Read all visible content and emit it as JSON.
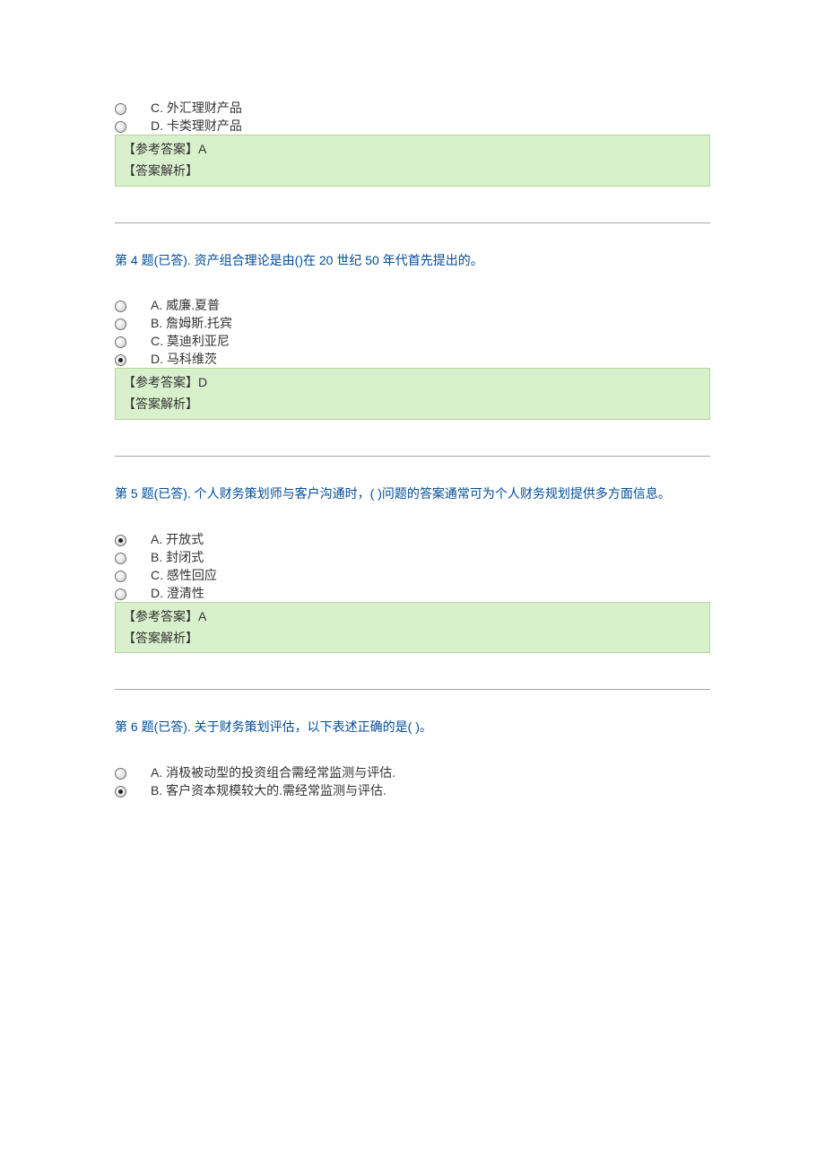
{
  "labels": {
    "ref_answer_prefix": "【参考答案】",
    "explain_label": "【答案解析】"
  },
  "q3tail": {
    "options": [
      {
        "key": "C",
        "text": "C. 外汇理财产品",
        "selected": false
      },
      {
        "key": "D",
        "text": "D. 卡类理财产品",
        "selected": false
      }
    ],
    "answer": "A"
  },
  "q4": {
    "title": "第 4 题(已答). 资产组合理论是由()在 20 世纪 50 年代首先提出的。",
    "options": [
      {
        "key": "A",
        "text": "A. 威廉.夏普",
        "selected": false
      },
      {
        "key": "B",
        "text": "B. 詹姆斯.托宾",
        "selected": false
      },
      {
        "key": "C",
        "text": "C. 莫迪利亚尼",
        "selected": false
      },
      {
        "key": "D",
        "text": "D. 马科维茨",
        "selected": true
      }
    ],
    "answer": "D"
  },
  "q5": {
    "title": "第 5 题(已答). 个人财务策划师与客户沟通时，(   )问题的答案通常可为个人财务规划提供多方面信息。",
    "options": [
      {
        "key": "A",
        "text": "A. 开放式",
        "selected": true
      },
      {
        "key": "B",
        "text": "B. 封闭式",
        "selected": false
      },
      {
        "key": "C",
        "text": "C. 感性回应",
        "selected": false
      },
      {
        "key": "D",
        "text": "D. 澄清性",
        "selected": false
      }
    ],
    "answer": "A"
  },
  "q6": {
    "title": "第 6 题(已答). 关于财务策划评估，以下表述正确的是(    )。",
    "options": [
      {
        "key": "A",
        "text": "A. 消极被动型的投资组合需经常监测与评估.",
        "selected": false
      },
      {
        "key": "B",
        "text": "B. 客户资本规模较大的.需经常监测与评估.",
        "selected": true
      }
    ]
  }
}
